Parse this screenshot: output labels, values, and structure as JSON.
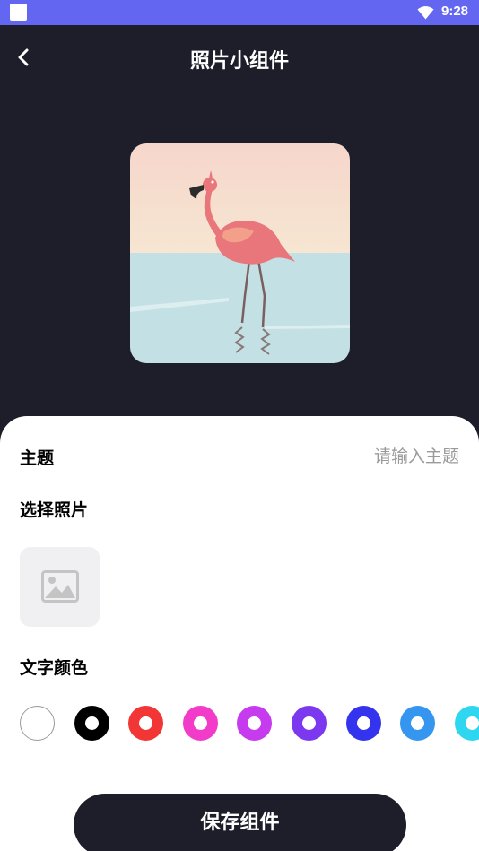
{
  "status_bar": {
    "time": "9:28"
  },
  "header": {
    "title": "照片小组件"
  },
  "form": {
    "topic_label": "主题",
    "topic_placeholder": "请输入主题",
    "topic_value": "",
    "photo_label": "选择照片",
    "color_label": "文字颜色"
  },
  "colors": [
    {
      "name": "white",
      "hex": "#ffffff"
    },
    {
      "name": "black",
      "hex": "#000000"
    },
    {
      "name": "red",
      "hex": "#f23535"
    },
    {
      "name": "pink",
      "hex": "#f23bc8"
    },
    {
      "name": "magenta",
      "hex": "#c73bef"
    },
    {
      "name": "violet",
      "hex": "#7b38ee"
    },
    {
      "name": "blue",
      "hex": "#3434ee"
    },
    {
      "name": "sky-blue",
      "hex": "#3496ee"
    },
    {
      "name": "cyan",
      "hex": "#2fd6ef"
    }
  ],
  "save_label": "保存组件",
  "theme": {
    "accent": "#6366f1",
    "dark": "#1e1e2a"
  }
}
